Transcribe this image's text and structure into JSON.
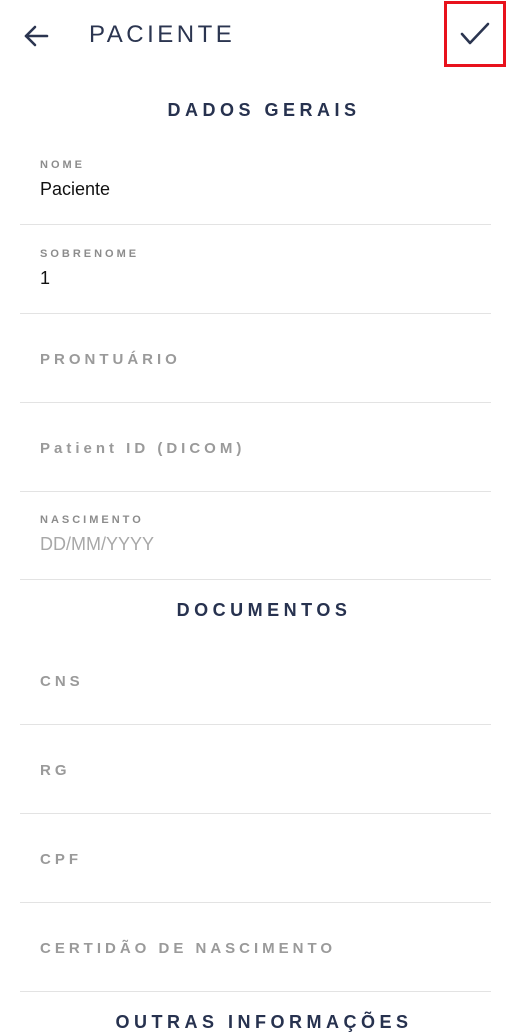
{
  "header": {
    "title": "PACIENTE",
    "back_icon": "arrow-left-icon",
    "confirm_icon": "check-icon",
    "confirm_highlight_color": "#e8121c"
  },
  "sections": {
    "general": {
      "title": "DADOS GERAIS",
      "fields": {
        "nome": {
          "label": "NOME",
          "value": "Paciente"
        },
        "sobrenome": {
          "label": "SOBRENOME",
          "value": "1"
        },
        "prontuario": {
          "label": "PRONTUÁRIO"
        },
        "patient_id": {
          "label": "Patient ID (DICOM)"
        },
        "nascimento": {
          "label": "NASCIMENTO",
          "placeholder": "DD/MM/YYYY"
        }
      }
    },
    "documents": {
      "title": "DOCUMENTOS",
      "fields": {
        "cns": {
          "label": "CNS"
        },
        "rg": {
          "label": "RG"
        },
        "cpf": {
          "label": "CPF"
        },
        "certidao": {
          "label": "CERTIDÃO DE NASCIMENTO"
        }
      }
    },
    "other": {
      "title": "OUTRAS INFORMAÇÕES"
    }
  },
  "colors": {
    "title_text": "#27324f",
    "label_text": "#9a9a9a",
    "divider": "#e3e3e3"
  }
}
